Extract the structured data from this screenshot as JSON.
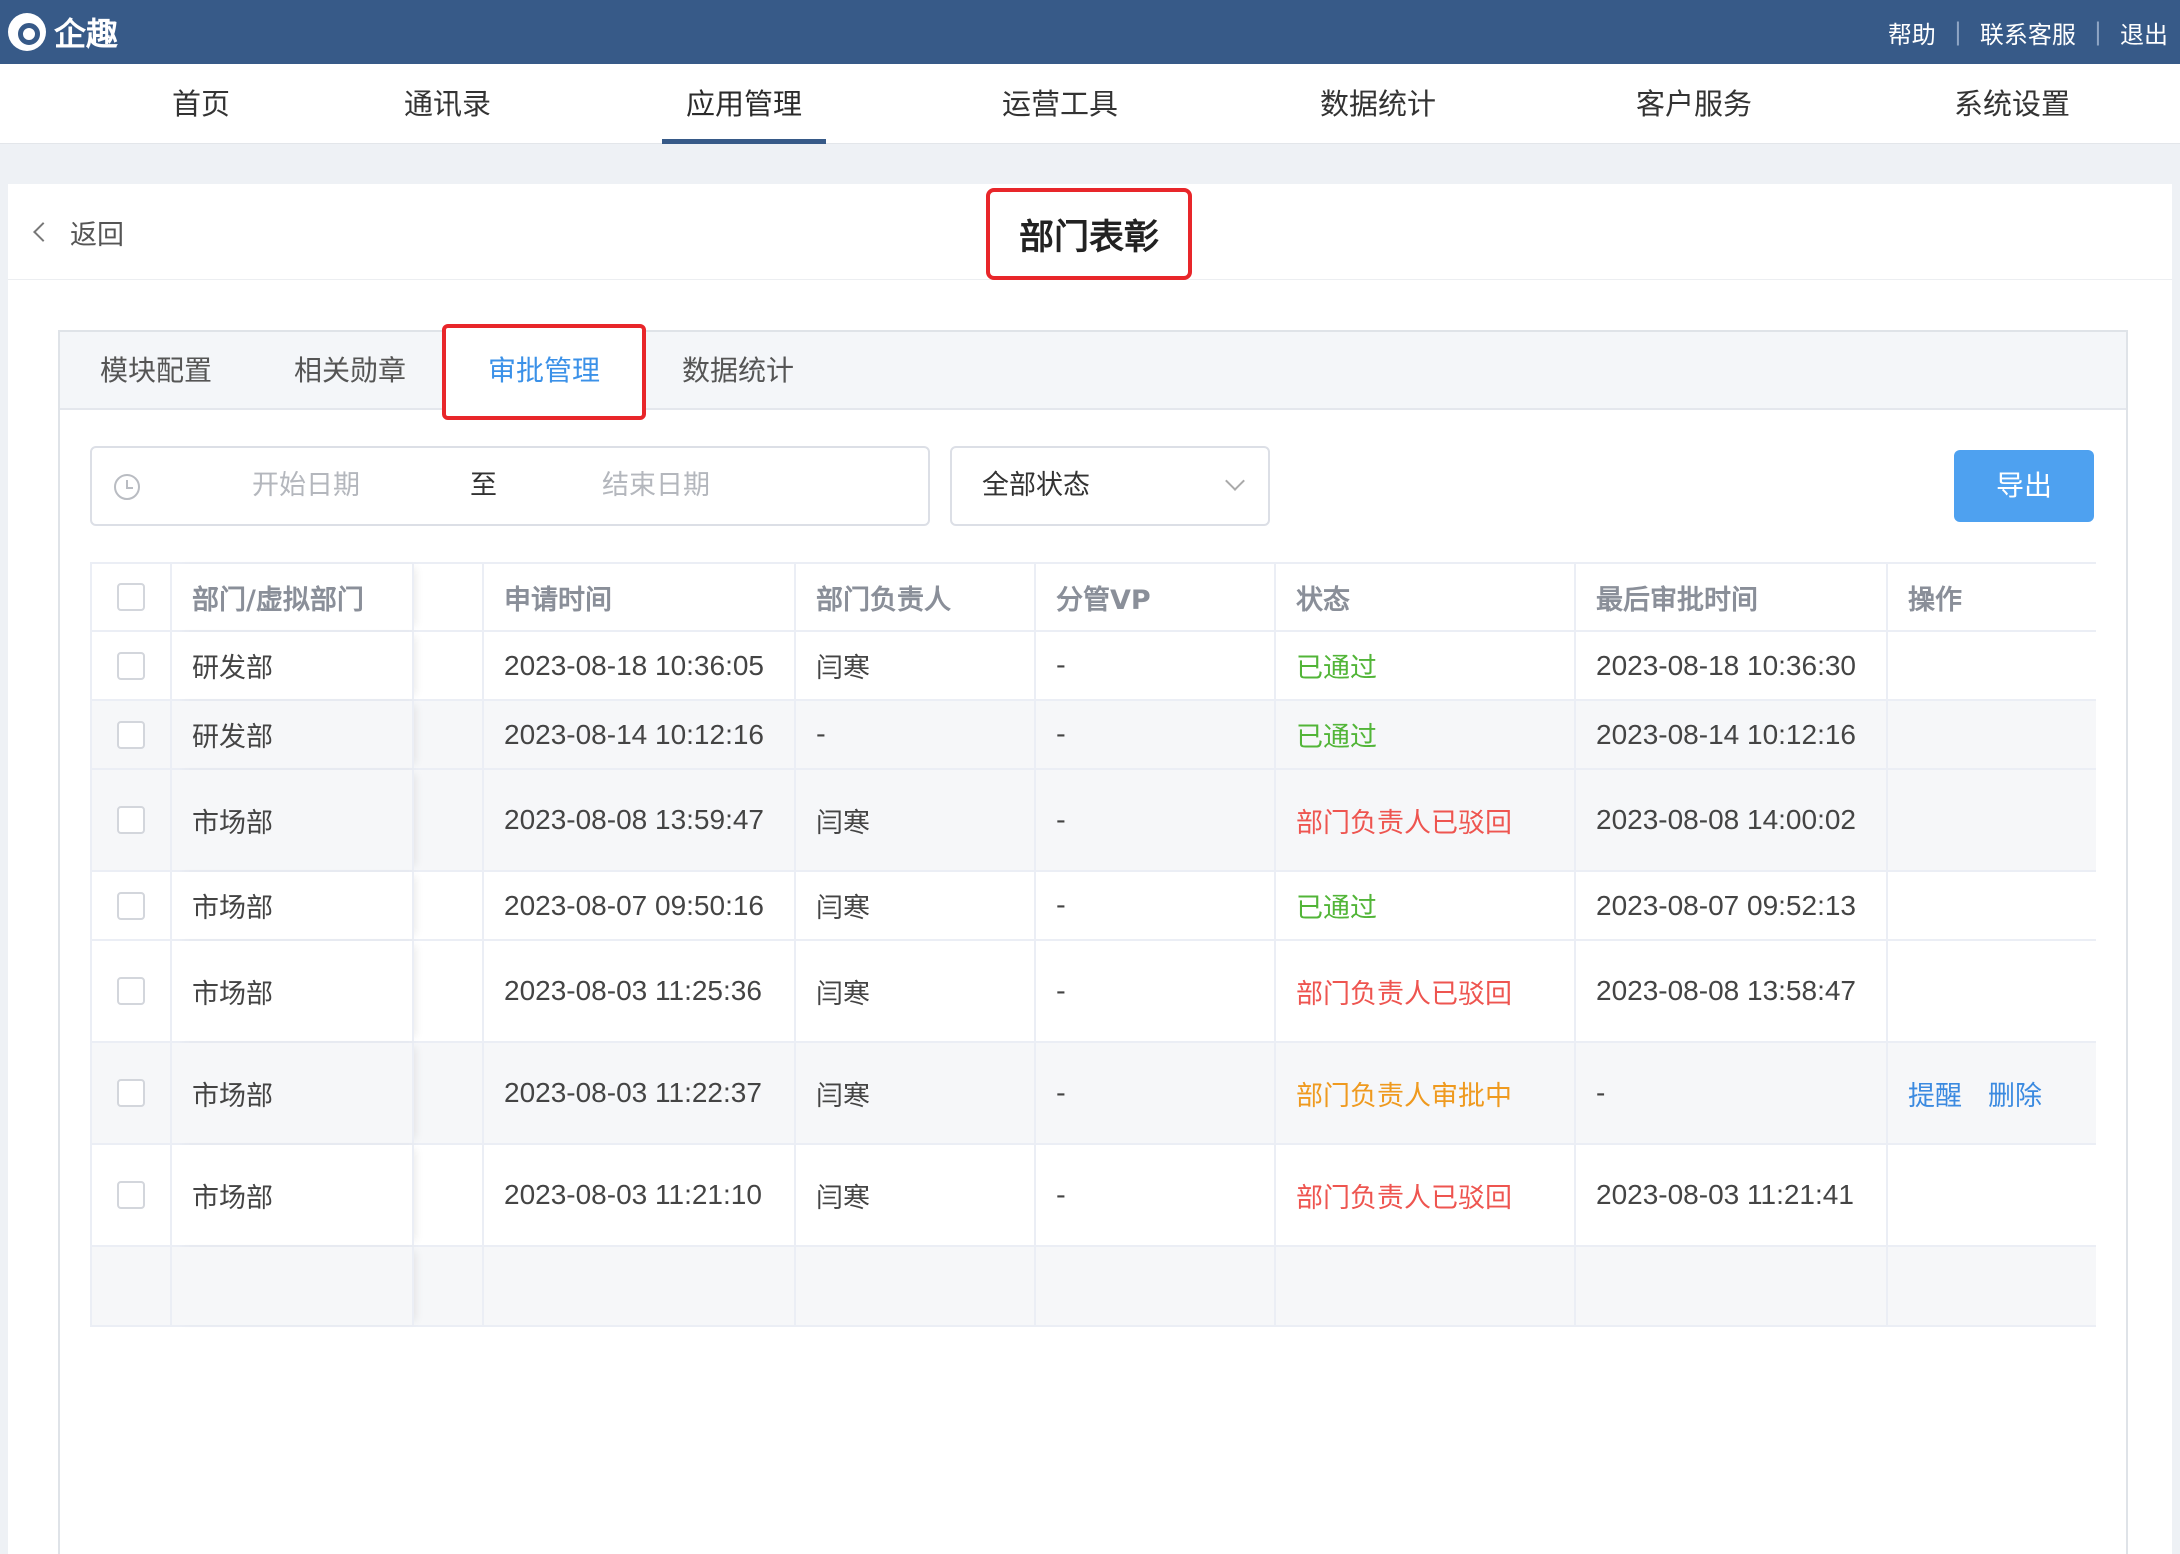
{
  "app": {
    "name": "企趣"
  },
  "top_links": [
    "帮助",
    "联系客服",
    "退出"
  ],
  "nav": [
    "首页",
    "通讯录",
    "应用管理",
    "运营工具",
    "数据统计",
    "客户服务",
    "系统设置"
  ],
  "header": {
    "back": "返回",
    "title": "部门表彰"
  },
  "tabs": [
    "模块配置",
    "相关勋章",
    "审批管理",
    "数据统计"
  ],
  "filters": {
    "start_placeholder": "开始日期",
    "sep": "至",
    "end_placeholder": "结束日期",
    "status": "全部状态",
    "export": "导出"
  },
  "table": {
    "columns": [
      "部门/虚拟部门",
      "申请时间",
      "部门负责人",
      "分管VP",
      "状态",
      "最后审批时间",
      "操作"
    ],
    "rows": [
      {
        "dept": "研发部",
        "time": "2023-08-18 10:36:05",
        "owner": "闫寒",
        "vp": "-",
        "status": "已通过",
        "last": "2023-08-18 10:36:30",
        "ops": [
          "",
          ""
        ]
      },
      {
        "dept": "研发部",
        "time": "2023-08-14 10:12:16",
        "owner": "-",
        "vp": "-",
        "status": "已通过",
        "last": "2023-08-14 10:12:16",
        "ops": [
          "",
          ""
        ]
      },
      {
        "dept": "市场部",
        "time": "2023-08-08 13:59:47",
        "owner": "闫寒",
        "vp": "-",
        "status": "部门负责人已驳回",
        "last": "2023-08-08 14:00:02",
        "ops": [
          "",
          ""
        ]
      },
      {
        "dept": "市场部",
        "time": "2023-08-07 09:50:16",
        "owner": "闫寒",
        "vp": "-",
        "status": "已通过",
        "last": "2023-08-07 09:52:13",
        "ops": [
          "",
          ""
        ]
      },
      {
        "dept": "市场部",
        "time": "2023-08-03 11:25:36",
        "owner": "闫寒",
        "vp": "-",
        "status": "部门负责人已驳回",
        "last": "2023-08-08 13:58:47",
        "ops": [
          "",
          ""
        ]
      },
      {
        "dept": "市场部",
        "time": "2023-08-03 11:22:37",
        "owner": "闫寒",
        "vp": "-",
        "status": "部门负责人审批中",
        "last": "-",
        "ops": [
          "提醒",
          "删除"
        ]
      },
      {
        "dept": "市场部",
        "time": "2023-08-03 11:21:10",
        "owner": "闫寒",
        "vp": "-",
        "status": "部门负责人已驳回",
        "last": "2023-08-03 11:21:41",
        "ops": [
          "",
          ""
        ]
      }
    ]
  },
  "colors": {
    "brand": "#375a88",
    "primary": "#3b91e8",
    "approved": "#52b538",
    "rejected": "#ee5550",
    "pending": "#ef9a1f",
    "highlight": "#e8262a"
  }
}
